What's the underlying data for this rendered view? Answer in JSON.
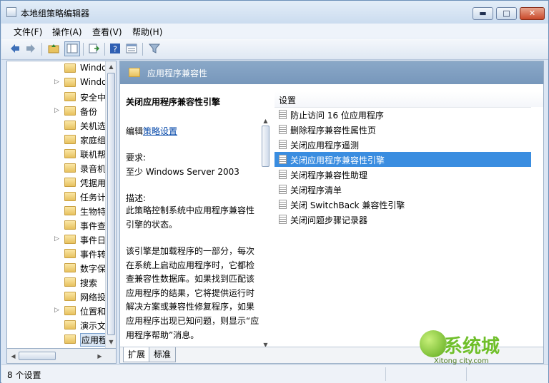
{
  "window": {
    "title": "本地组策略编辑器",
    "min": "▬",
    "max": "□",
    "close": "✕"
  },
  "menu": [
    {
      "label": "文件(F)"
    },
    {
      "label": "操作(A)"
    },
    {
      "label": "查看(V)"
    },
    {
      "label": "帮助(H)"
    }
  ],
  "toolbar": [
    "back-arrow-icon",
    "forward-arrow-icon",
    "up-folder-icon",
    "show-tree-icon",
    "export-icon",
    "help-icon",
    "properties-icon",
    "filter-icon"
  ],
  "tree": {
    "items": [
      {
        "label": "Windo",
        "expander": ""
      },
      {
        "label": "Windo",
        "expander": "▷"
      },
      {
        "label": "安全中",
        "expander": ""
      },
      {
        "label": "备份",
        "expander": "▷"
      },
      {
        "label": "关机选",
        "expander": ""
      },
      {
        "label": "家庭组",
        "expander": ""
      },
      {
        "label": "联机帮",
        "expander": ""
      },
      {
        "label": "录音机",
        "expander": ""
      },
      {
        "label": "凭据用",
        "expander": ""
      },
      {
        "label": "任务计",
        "expander": ""
      },
      {
        "label": "生物特",
        "expander": ""
      },
      {
        "label": "事件查",
        "expander": ""
      },
      {
        "label": "事件日",
        "expander": "▷"
      },
      {
        "label": "事件转",
        "expander": ""
      },
      {
        "label": "数字保",
        "expander": ""
      },
      {
        "label": "搜索",
        "expander": ""
      },
      {
        "label": "网络投",
        "expander": ""
      },
      {
        "label": "位置和",
        "expander": "▷"
      },
      {
        "label": "演示文",
        "expander": ""
      },
      {
        "label": "应用程",
        "expander": "",
        "selected": true
      }
    ]
  },
  "header": {
    "title": "应用程序兼容性"
  },
  "description": {
    "title": "关闭应用程序兼容性引擎",
    "edit_prefix": "编辑",
    "edit_link": "策略设置",
    "requirements_label": "要求:",
    "requirements_value": "至少 Windows Server 2003",
    "description_label": "描述:",
    "description_text": " 此策略控制系统中应用程序兼容性引擎的状态。",
    "detail_text": "该引擎是加载程序的一部分，每次在系统上启动应用程序时，它都检查兼容性数据库。如果找到匹配该应用程序的结果，它将提供运行时解决方案或兼容性修复程序，如果应用程序出现已知问题，则显示“应用程序帮助”消息。"
  },
  "list": {
    "header": "设置",
    "items": [
      {
        "label": "防止访问 16 位应用程序",
        "selected": false
      },
      {
        "label": "删除程序兼容性属性页",
        "selected": false
      },
      {
        "label": "关闭应用程序遥测",
        "selected": false
      },
      {
        "label": "关闭应用程序兼容性引擎",
        "selected": true
      },
      {
        "label": "关闭程序兼容性助理",
        "selected": false
      },
      {
        "label": "关闭程序清单",
        "selected": false
      },
      {
        "label": "关闭 SwitchBack 兼容性引擎",
        "selected": false
      },
      {
        "label": "关闭问题步骤记录器",
        "selected": false
      }
    ]
  },
  "tabs": [
    {
      "label": "扩展",
      "active": true
    },
    {
      "label": "标准",
      "active": false
    }
  ],
  "status": {
    "text": "8 个设置"
  },
  "watermark": {
    "text": "系统城",
    "url": "Xitong city.com"
  }
}
